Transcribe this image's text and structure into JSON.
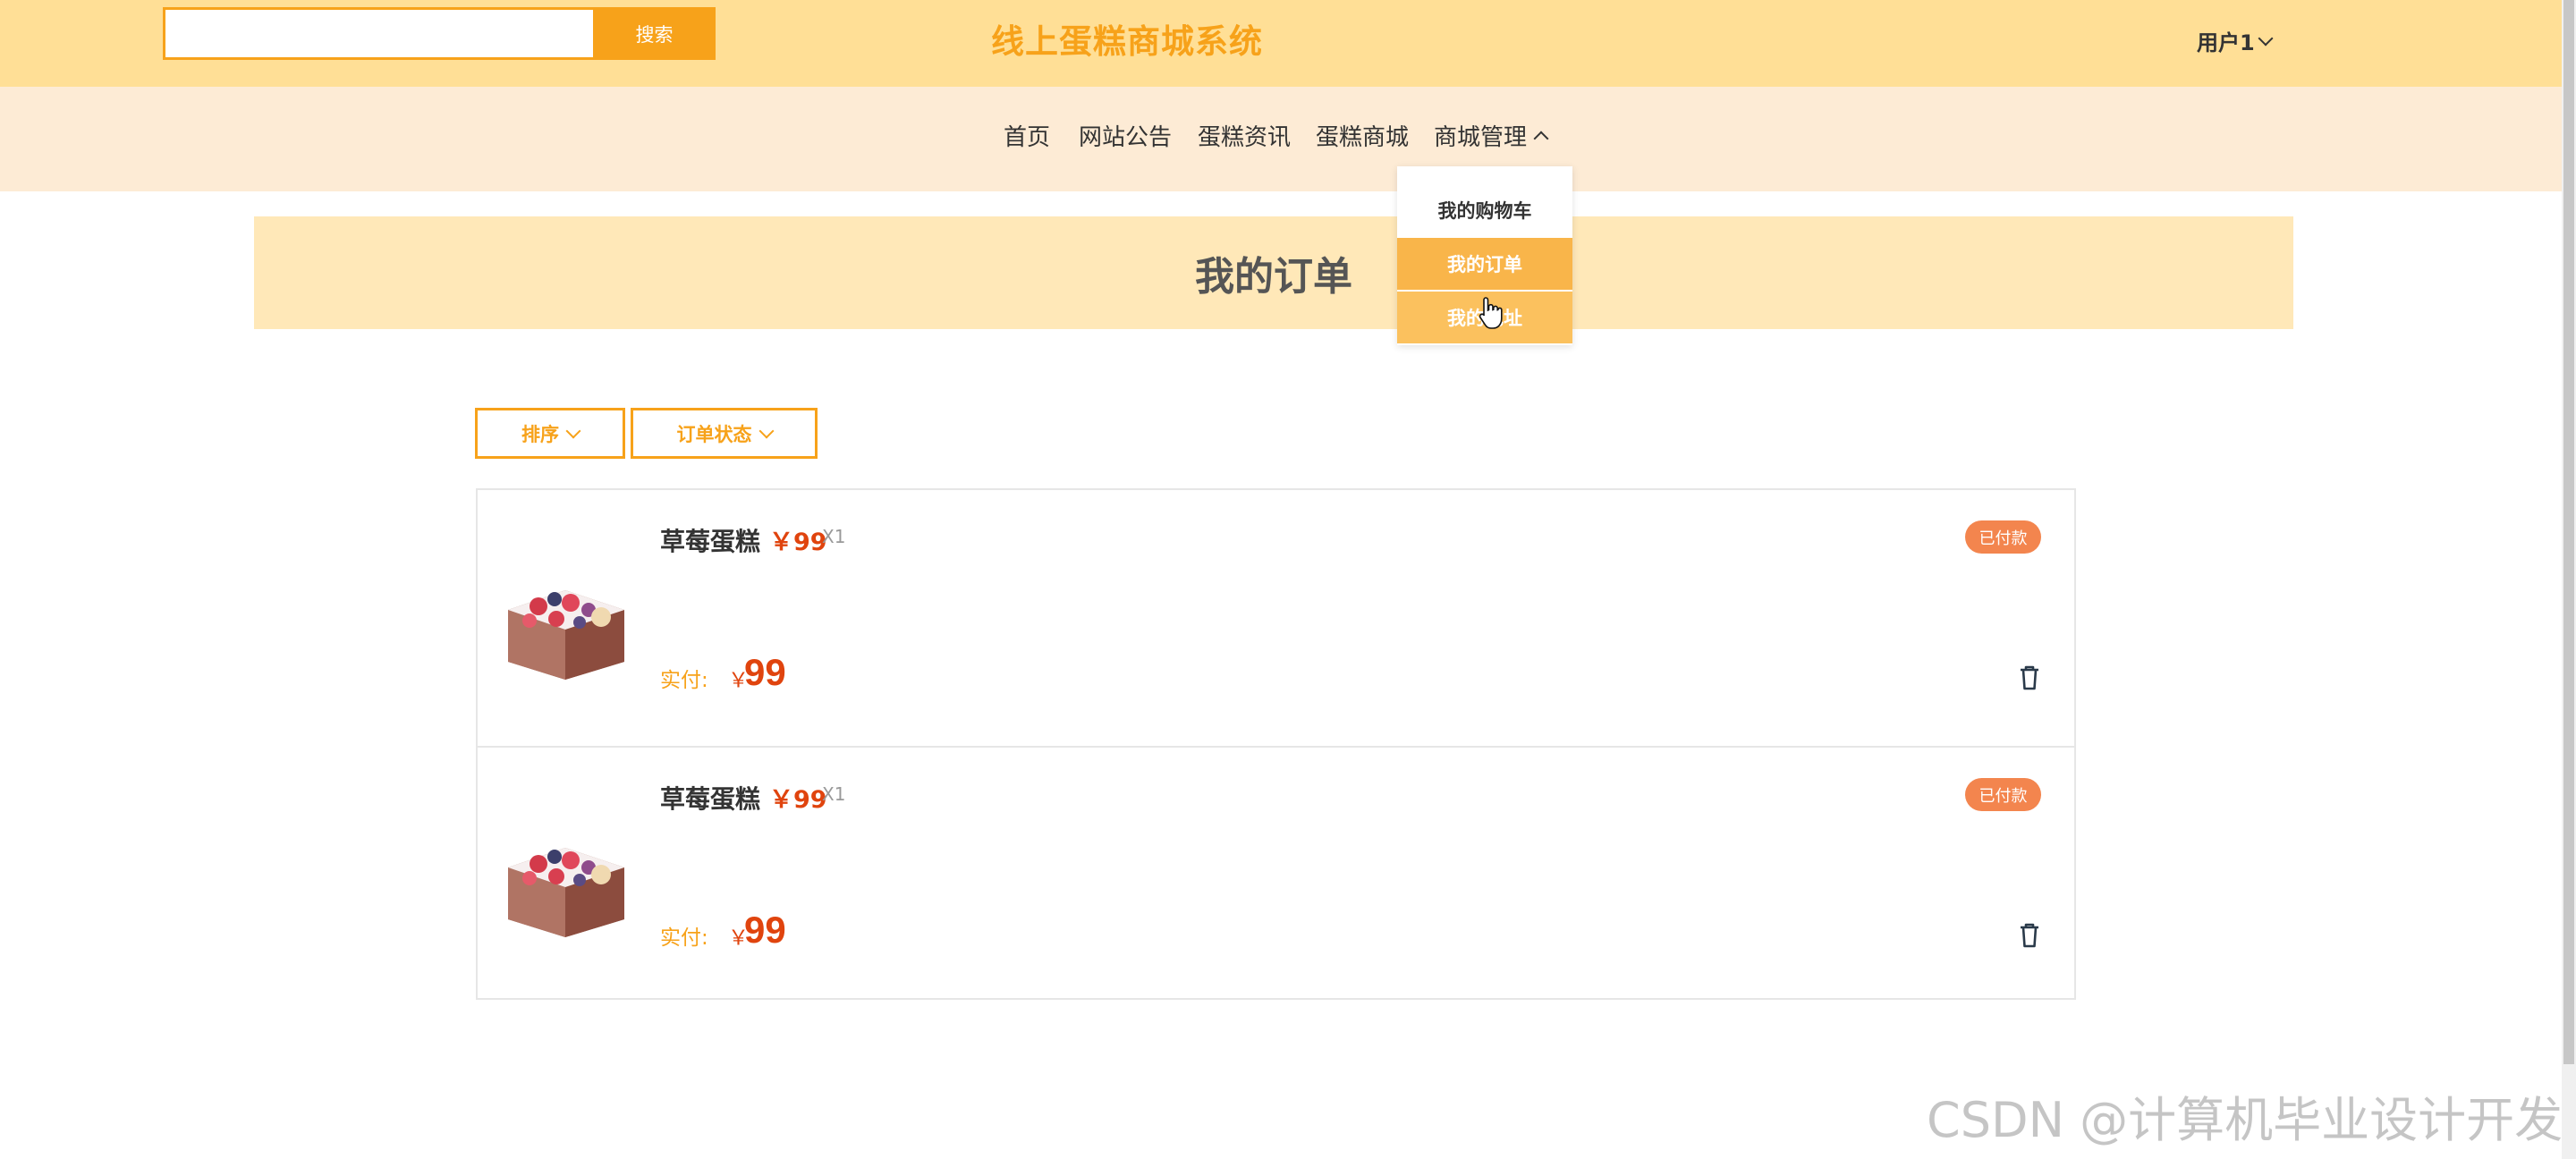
{
  "header": {
    "search_placeholder": "",
    "search_button": "搜索",
    "site_title": "线上蛋糕商城系统",
    "user_menu": "用户1"
  },
  "nav": {
    "items": [
      "首页",
      "网站公告",
      "蛋糕资讯",
      "蛋糕商城",
      "商城管理"
    ]
  },
  "dropdown": {
    "items": [
      "我的购物车",
      "我的订单",
      "我的地址"
    ]
  },
  "page": {
    "title": "我的订单"
  },
  "filters": {
    "sort": "排序",
    "status": "订单状态"
  },
  "orders": [
    {
      "name": "草莓蛋糕",
      "price": "￥99",
      "qty": "X1",
      "paid_label": "实付:",
      "paid_currency": "￥",
      "paid_amount": "99",
      "status": "已付款"
    },
    {
      "name": "草莓蛋糕",
      "price": "￥99",
      "qty": "X1",
      "paid_label": "实付:",
      "paid_currency": "￥",
      "paid_amount": "99",
      "status": "已付款"
    }
  ],
  "watermark": "CSDN @计算机毕业设计开发",
  "colors": {
    "accent": "#f7a21a",
    "header_bg": "#ffdf96",
    "nav_bg": "#fdebd5",
    "banner_bg": "#ffe8b8",
    "price": "#e0440e",
    "badge": "#f3854e"
  }
}
